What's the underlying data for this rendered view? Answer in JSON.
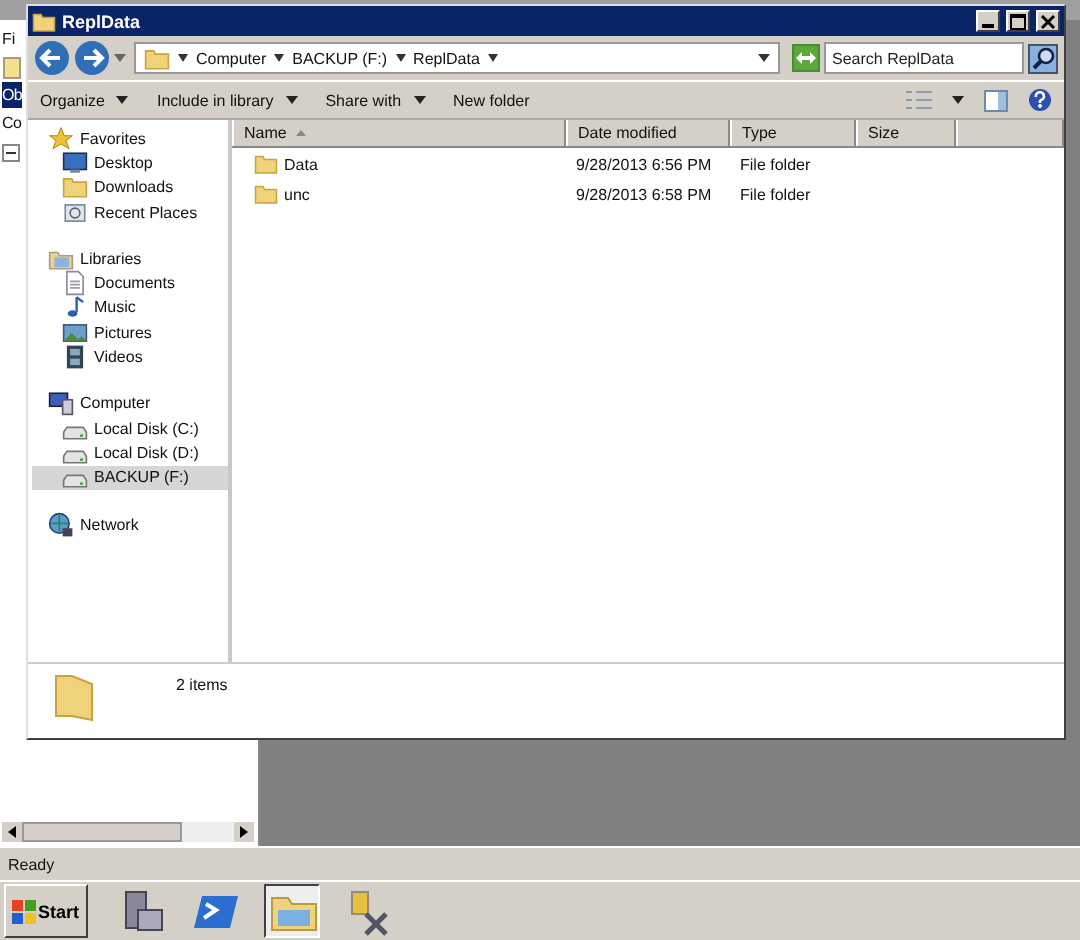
{
  "background_app": {
    "menu_fragment": "Fi",
    "tabs": [
      {
        "label": "Ob",
        "selected": true
      },
      {
        "label": "Co",
        "selected": false
      }
    ],
    "status_bar": "Ready"
  },
  "window": {
    "title": "ReplData"
  },
  "address": {
    "crumbs": [
      "Computer",
      "BACKUP (F:)",
      "ReplData"
    ]
  },
  "search": {
    "placeholder": "Search ReplData"
  },
  "toolbar": [
    {
      "label": "Organize",
      "dropdown": true
    },
    {
      "label": "Include in library",
      "dropdown": true
    },
    {
      "label": "Share with",
      "dropdown": true
    },
    {
      "label": "New folder",
      "dropdown": false
    }
  ],
  "nav": [
    {
      "label": "Favorites",
      "kind": "star",
      "children": [
        {
          "label": "Desktop",
          "kind": "desktop",
          "selected": false
        },
        {
          "label": "Downloads",
          "kind": "folder",
          "selected": false
        },
        {
          "label": "Recent Places",
          "kind": "recent",
          "selected": false
        }
      ]
    },
    {
      "label": "Libraries",
      "kind": "library",
      "children": [
        {
          "label": "Documents",
          "kind": "document",
          "selected": false
        },
        {
          "label": "Music",
          "kind": "music",
          "selected": false
        },
        {
          "label": "Pictures",
          "kind": "picture",
          "selected": false
        },
        {
          "label": "Videos",
          "kind": "film",
          "selected": false
        }
      ]
    },
    {
      "label": "Computer",
      "kind": "computer",
      "children": [
        {
          "label": "Local Disk (C:)",
          "kind": "drive",
          "selected": false
        },
        {
          "label": "Local Disk (D:)",
          "kind": "drive",
          "selected": false
        },
        {
          "label": "BACKUP (F:)",
          "kind": "drive",
          "selected": true
        }
      ]
    },
    {
      "label": "Network",
      "kind": "globe"
    }
  ],
  "table": {
    "columns": [
      {
        "label": "Name",
        "sorted": true
      },
      {
        "label": "Date modified",
        "sorted": false
      },
      {
        "label": "Type",
        "sorted": false
      },
      {
        "label": "Size",
        "sorted": false
      }
    ],
    "rows": [
      {
        "name": "Data",
        "date": "9/28/2013 6:56 PM",
        "type": "File folder"
      },
      {
        "name": "unc",
        "date": "9/28/2013 6:58 PM",
        "type": "File folder"
      }
    ]
  },
  "details": {
    "text": "2 items"
  },
  "taskbar": {
    "start": "Start",
    "apps": [
      {
        "kind": "server",
        "selected": false
      },
      {
        "kind": "shell",
        "selected": false
      },
      {
        "kind": "explorer",
        "selected": true
      },
      {
        "kind": "tools",
        "selected": false
      }
    ]
  }
}
